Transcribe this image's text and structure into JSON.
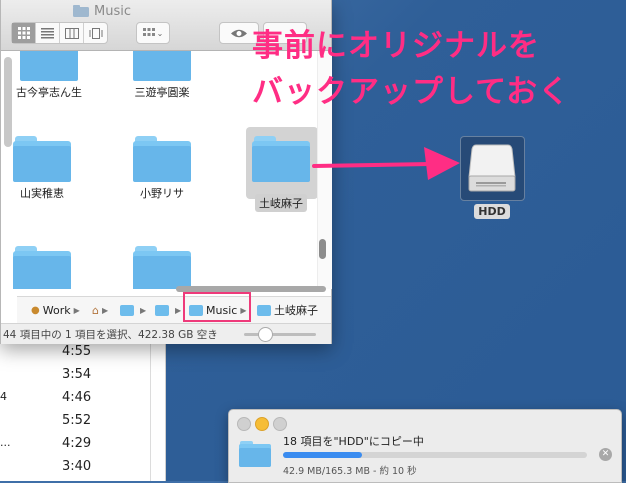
{
  "finder": {
    "title": "Music",
    "items": [
      {
        "label": "古今亭志ん生"
      },
      {
        "label": "三遊亭圓楽"
      },
      {
        "label": "山実稚恵"
      },
      {
        "label": "小野リサ"
      },
      {
        "label": "土岐麻子"
      }
    ],
    "pathbar": {
      "items": [
        "Work",
        "Music",
        "土岐麻子"
      ]
    },
    "status": "44 項目中の 1 項目を選択、422.38 GB 空き"
  },
  "background_list": {
    "rows": [
      {
        "prefix": "",
        "time": "4:55"
      },
      {
        "prefix": "",
        "time": "3:54"
      },
      {
        "prefix": "4",
        "time": "4:46"
      },
      {
        "prefix": "",
        "time": "5:52"
      },
      {
        "prefix": "...",
        "time": "4:29"
      },
      {
        "prefix": "",
        "time": "3:40"
      }
    ]
  },
  "annotation": {
    "line1": "事前にオリジナルを",
    "line2": "バックアップしておく",
    "color": "#ff2d84"
  },
  "hdd": {
    "label": "HDD"
  },
  "copy": {
    "title": "18 項目を\"HDD\"にコピー中",
    "detail": "42.9 MB/165.3 MB - 約 10 秒",
    "progress": 0.26,
    "accent": "#3a8cf0"
  }
}
